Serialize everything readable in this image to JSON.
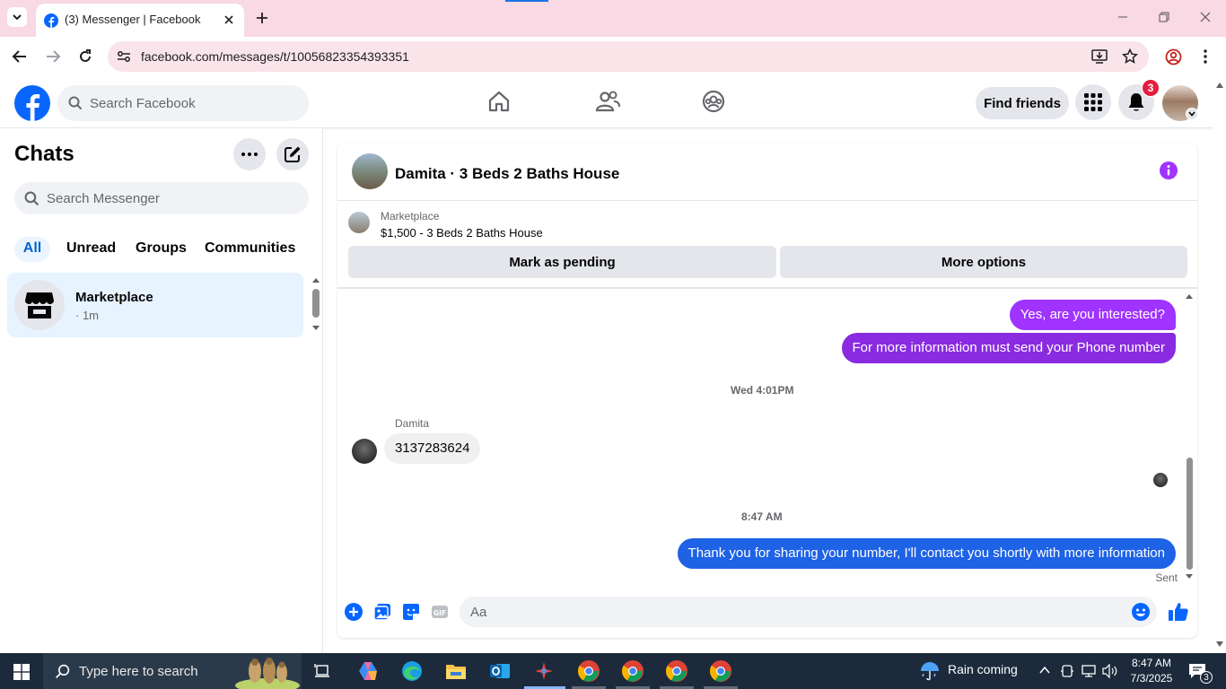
{
  "browser": {
    "tab_title": "(3) Messenger | Facebook",
    "url": "facebook.com/messages/t/10056823354393351"
  },
  "fb_header": {
    "search_placeholder": "Search Facebook",
    "find_friends_label": "Find friends",
    "notification_count": "3"
  },
  "chats_panel": {
    "title": "Chats",
    "search_placeholder": "Search Messenger",
    "filters": [
      "All",
      "Unread",
      "Groups",
      "Communities"
    ],
    "active_filter": "All",
    "items": [
      {
        "name": "Marketplace",
        "time": "· 1m"
      }
    ]
  },
  "conversation": {
    "title": "Damita · 3 Beds 2 Baths House",
    "marketplace_label": "Marketplace",
    "listing": "$1,500 - 3 Beds 2 Baths House",
    "mark_pending_label": "Mark as pending",
    "more_options_label": "More options",
    "messages": [
      {
        "from": "me",
        "text": "Yes, are you interested?"
      },
      {
        "from": "me",
        "text": "For more information must send your Phone number"
      },
      {
        "type": "timestamp",
        "text": "Wed 4:01PM"
      },
      {
        "from": "Damita",
        "sender_label": "Damita",
        "text": "3137283624"
      },
      {
        "type": "timestamp",
        "text": "8:47 AM"
      },
      {
        "from": "me",
        "text": "Thank you for sharing your number, I'll contact you shortly with more information"
      }
    ],
    "status": "Sent",
    "composer_placeholder": "Aa"
  },
  "taskbar": {
    "search_placeholder": "Type here to search",
    "weather": "Rain coming",
    "time": "8:47 AM",
    "date": "7/3/2025",
    "notification_count": "3"
  },
  "colors": {
    "outgoing_purple": "#a033ff",
    "outgoing_blue": "#1e62e6",
    "fb_blue": "#0866ff",
    "accent_blue": "#0064d1"
  }
}
